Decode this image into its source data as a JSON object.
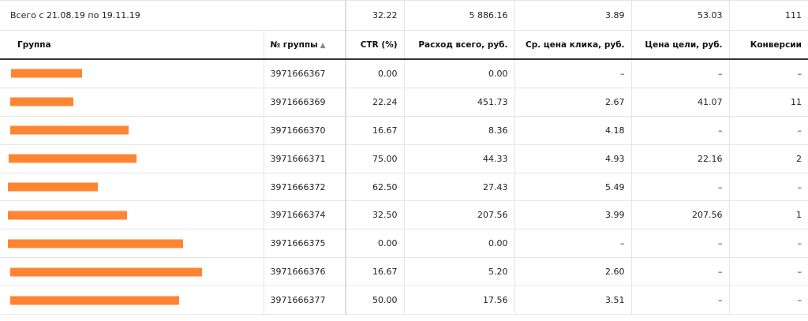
{
  "summary": {
    "period": "Всего с 21.08.19 по 19.11.19",
    "ctr": "32.22",
    "cost": "5 886.16",
    "cpc": "3.89",
    "goal_cost": "53.03",
    "conversions": "111"
  },
  "headers": {
    "group": "Группа",
    "group_num": "№ группы",
    "sort_icon": "▲",
    "ctr": "CTR (%)",
    "cost": "Расход всего, руб.",
    "cpc": "Ср. цена клика, руб.",
    "goal_cost": "Цена цели, руб.",
    "conversions": "Конверсии"
  },
  "rows": [
    {
      "num": "3971666367",
      "ctr": "0.00",
      "cost": "0.00",
      "cpc": "–",
      "goal": "–",
      "conv": "–"
    },
    {
      "num": "3971666369",
      "ctr": "22.24",
      "cost": "451.73",
      "cpc": "2.67",
      "goal": "41.07",
      "conv": "11"
    },
    {
      "num": "3971666370",
      "ctr": "16.67",
      "cost": "8.36",
      "cpc": "4.18",
      "goal": "–",
      "conv": "–"
    },
    {
      "num": "3971666371",
      "ctr": "75.00",
      "cost": "44.33",
      "cpc": "4.93",
      "goal": "22.16",
      "conv": "2"
    },
    {
      "num": "3971666372",
      "ctr": "62.50",
      "cost": "27.43",
      "cpc": "5.49",
      "goal": "–",
      "conv": "–"
    },
    {
      "num": "3971666374",
      "ctr": "32.50",
      "cost": "207.56",
      "cpc": "3.99",
      "goal": "207.56",
      "conv": "1"
    },
    {
      "num": "3971666375",
      "ctr": "0.00",
      "cost": "0.00",
      "cpc": "–",
      "goal": "–",
      "conv": "–"
    },
    {
      "num": "3971666376",
      "ctr": "16.67",
      "cost": "5.20",
      "cpc": "2.60",
      "goal": "–",
      "conv": "–"
    },
    {
      "num": "3971666377",
      "ctr": "50.00",
      "cost": "17.56",
      "cpc": "3.51",
      "goal": "–",
      "conv": "–"
    }
  ],
  "colors": {
    "redaction": "#ff8533",
    "underline": "#a9b4c7"
  }
}
